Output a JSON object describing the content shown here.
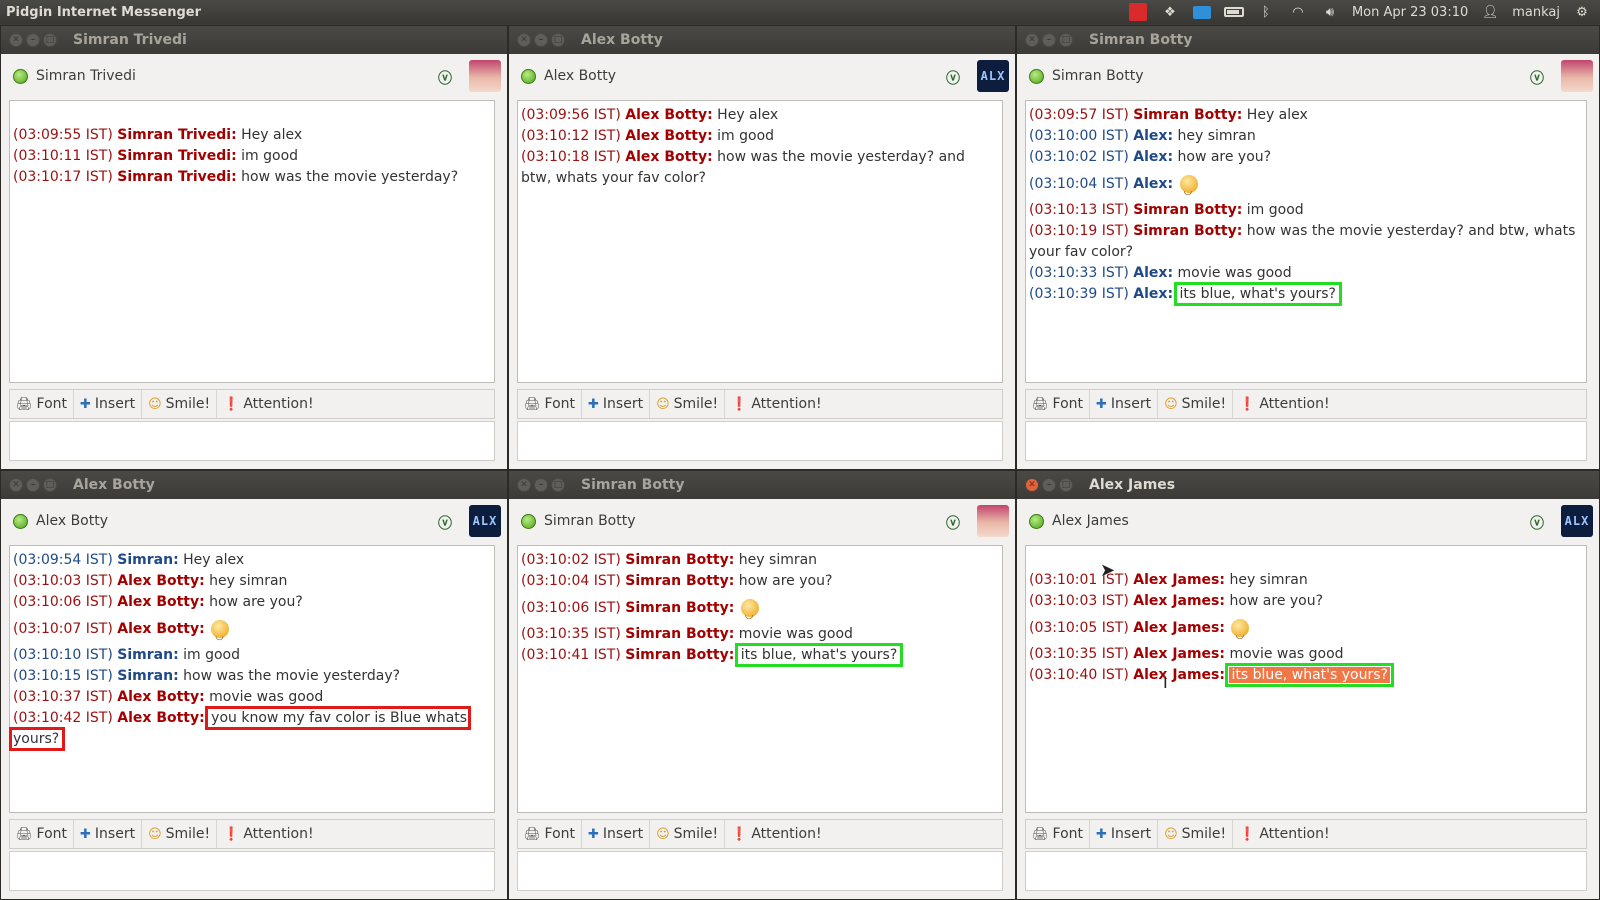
{
  "topbar": {
    "app_title": "Pidgin Internet Messenger",
    "clock": "Mon Apr 23 03:10",
    "user": "mankaj",
    "icons": [
      "indicator-red-icon",
      "dropbox-icon",
      "mail-icon",
      "battery-icon",
      "bluetooth-icon",
      "wifi-icon",
      "volume-icon",
      "user-icon",
      "gear-icon"
    ]
  },
  "toolbar_labels": {
    "font": "Font",
    "insert": "Insert",
    "smile": "Smile!",
    "attention": "Attention!"
  },
  "windows": [
    {
      "title": "Simran Trivedi",
      "buddy": "Simran Trivedi",
      "avatar": "girl",
      "messages": [
        {
          "ts": "(03:09:55  IST)",
          "name": "Simran Trivedi:",
          "text": "Hey alex",
          "color": "red"
        },
        {
          "ts": "(03:10:11  IST)",
          "name": "Simran Trivedi:",
          "text": "im good",
          "color": "red"
        },
        {
          "ts": "(03:10:17  IST)",
          "name": "Simran Trivedi:",
          "text": "how was the movie yesterday?",
          "color": "red"
        }
      ]
    },
    {
      "title": "Alex Botty",
      "buddy": "Alex Botty",
      "avatar": "ALX",
      "messages": [
        {
          "ts": "(03:09:56  IST)",
          "name": "Alex Botty:",
          "text": "Hey alex",
          "color": "red"
        },
        {
          "ts": "(03:10:12  IST)",
          "name": "Alex Botty:",
          "text": "im good",
          "color": "red"
        },
        {
          "ts": "(03:10:18  IST)",
          "name": "Alex Botty:",
          "text": "how was the movie yesterday? and btw, whats your fav color?",
          "color": "red"
        }
      ]
    },
    {
      "title": "Simran Botty",
      "buddy": "Simran Botty",
      "avatar": "girl",
      "messages": [
        {
          "ts": "(03:09:57  IST)",
          "name": "Simran Botty:",
          "text": "Hey alex",
          "color": "red"
        },
        {
          "ts": "(03:10:00  IST)",
          "name": "Alex:",
          "text": "hey simran",
          "color": "blue"
        },
        {
          "ts": "(03:10:02  IST)",
          "name": "Alex:",
          "text": "how are you?",
          "color": "blue"
        },
        {
          "ts": "(03:10:04  IST)",
          "name": "Alex:",
          "text": "",
          "color": "blue",
          "smiley": true
        },
        {
          "ts": "(03:10:13  IST)",
          "name": "Simran Botty:",
          "text": "im good",
          "color": "red"
        },
        {
          "ts": "(03:10:19  IST)",
          "name": "Simran Botty:",
          "text": "how was the movie yesterday? and btw, whats your fav color?",
          "color": "red"
        },
        {
          "ts": "(03:10:33  IST)",
          "name": "Alex:",
          "text": "movie was good",
          "color": "blue"
        },
        {
          "ts": "(03:10:39  IST)",
          "name": "Alex:",
          "text": "its blue, what's yours?",
          "color": "blue",
          "highlight": "green"
        }
      ]
    },
    {
      "title": "Alex Botty",
      "buddy": "Alex Botty",
      "avatar": "ALX",
      "messages": [
        {
          "ts": "(03:09:54  IST)",
          "name": "Simran:",
          "text": "Hey alex",
          "color": "blue"
        },
        {
          "ts": "(03:10:03  IST)",
          "name": "Alex Botty:",
          "text": "hey simran",
          "color": "red"
        },
        {
          "ts": "(03:10:06  IST)",
          "name": "Alex Botty:",
          "text": "how are you?",
          "color": "red"
        },
        {
          "ts": "(03:10:07  IST)",
          "name": "Alex Botty:",
          "text": "",
          "color": "red",
          "smiley": true
        },
        {
          "ts": "(03:10:10  IST)",
          "name": "Simran:",
          "text": "im good",
          "color": "blue"
        },
        {
          "ts": "(03:10:15  IST)",
          "name": "Simran:",
          "text": "how was the movie yesterday?",
          "color": "blue"
        },
        {
          "ts": "(03:10:37  IST)",
          "name": "Alex Botty:",
          "text": "movie was good",
          "color": "red"
        },
        {
          "ts": "(03:10:42  IST)",
          "name": "Alex Botty:",
          "text": "you know my fav color is Blue whats yours?",
          "color": "red",
          "highlight": "red"
        }
      ]
    },
    {
      "title": "Simran Botty",
      "buddy": "Simran Botty",
      "avatar": "girl",
      "messages": [
        {
          "ts": "(03:10:02  IST)",
          "name": "Simran Botty:",
          "text": "hey simran",
          "color": "red"
        },
        {
          "ts": "(03:10:04  IST)",
          "name": "Simran Botty:",
          "text": "how are you?",
          "color": "red"
        },
        {
          "ts": "(03:10:06  IST)",
          "name": "Simran Botty:",
          "text": "",
          "color": "red",
          "smiley": true
        },
        {
          "ts": "(03:10:35  IST)",
          "name": "Simran Botty:",
          "text": "movie was good",
          "color": "red"
        },
        {
          "ts": "(03:10:41  IST)",
          "name": "Simran Botty:",
          "text": "its blue, what's yours?",
          "color": "red",
          "highlight": "green"
        }
      ]
    },
    {
      "title": "Alex James",
      "buddy": "Alex James",
      "avatar": "ALX",
      "active": true,
      "messages": [
        {
          "ts": "(03:10:01  IST)",
          "name": "Alex James:",
          "text": "hey simran",
          "color": "red"
        },
        {
          "ts": "(03:10:03  IST)",
          "name": "Alex James:",
          "text": "how are you?",
          "color": "red"
        },
        {
          "ts": "(03:10:05  IST)",
          "name": "Alex James:",
          "text": "",
          "color": "red",
          "smiley": true
        },
        {
          "ts": "(03:10:35  IST)",
          "name": "Alex James:",
          "text": "movie was good",
          "color": "red"
        },
        {
          "ts": "(03:10:40  IST)",
          "name": "Alex James:",
          "text": "its blue, what's yours?",
          "color": "red",
          "highlight": "green",
          "selected": true
        }
      ]
    }
  ]
}
